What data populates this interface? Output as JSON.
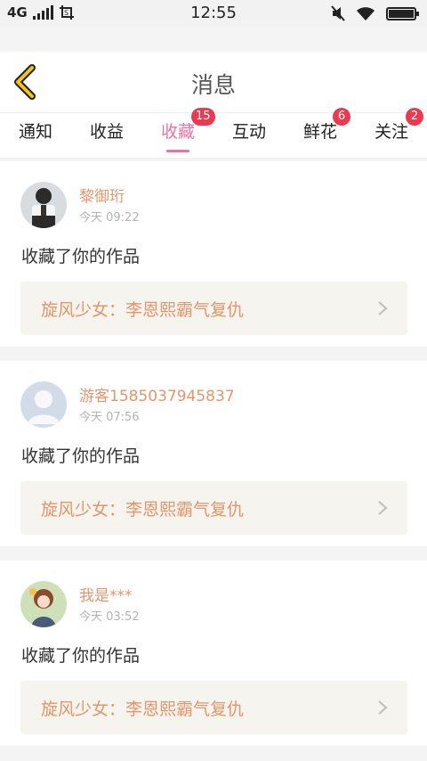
{
  "status": {
    "network": "4G",
    "time": "12:55"
  },
  "header": {
    "title": "消息"
  },
  "tabs": [
    {
      "label": "通知",
      "badge": ""
    },
    {
      "label": "收益",
      "badge": ""
    },
    {
      "label": "收藏",
      "badge": "15"
    },
    {
      "label": "互动",
      "badge": ""
    },
    {
      "label": "鲜花",
      "badge": "6"
    },
    {
      "label": "关注",
      "badge": "2"
    }
  ],
  "active_tab": "收藏",
  "colors": {
    "accent": "#e774a2",
    "name": "#e4956a",
    "badge": "#ea3a4f",
    "back": "#f0c419"
  },
  "items": [
    {
      "user": "黎御珩",
      "time": "今天 09:22",
      "message": "收藏了你的作品",
      "work": "旋风少女：李恩熙霸气复仇"
    },
    {
      "user": "游客1585037945837",
      "time": "今天 07:56",
      "message": "收藏了你的作品",
      "work": "旋风少女：李恩熙霸气复仇"
    },
    {
      "user": "我是***",
      "time": "今天 03:52",
      "message": "收藏了你的作品",
      "work": "旋风少女：李恩熙霸气复仇"
    }
  ]
}
